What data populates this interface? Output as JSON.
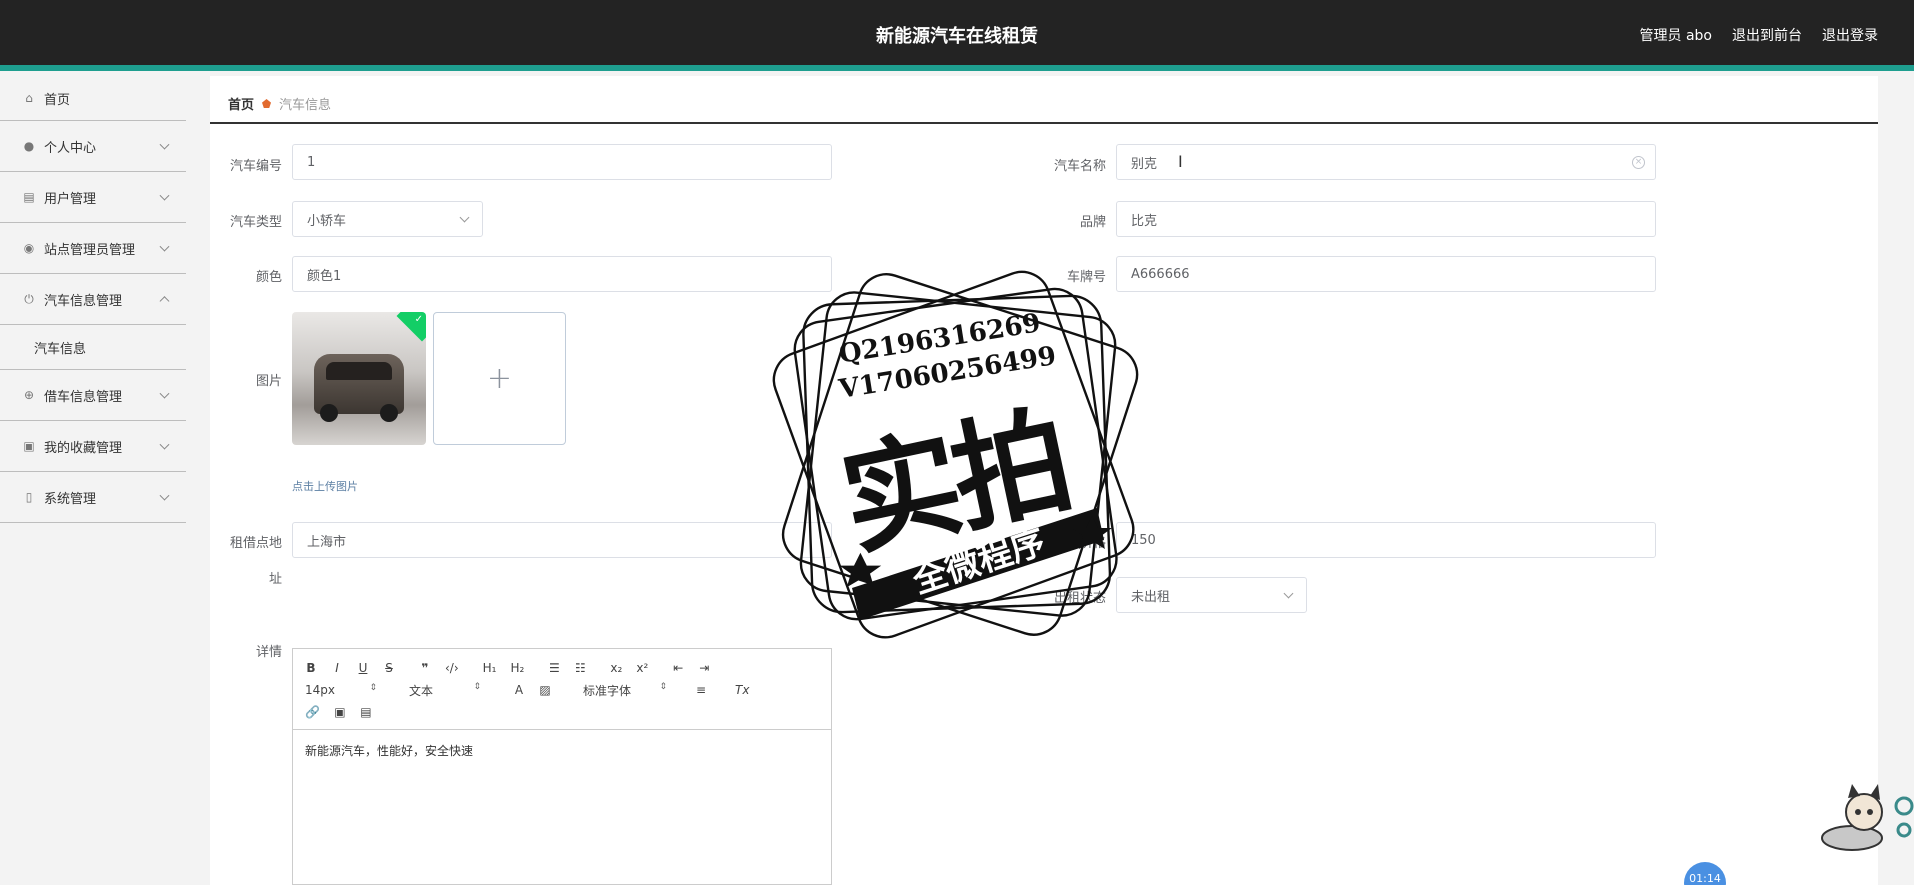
{
  "header": {
    "title": "新能源汽车在线租赁",
    "admin_label": "管理员 abo",
    "front_link": "退出到前台",
    "logout_link": "退出登录"
  },
  "sidebar": {
    "items": [
      {
        "label": "首页",
        "icon": "home-icon"
      },
      {
        "label": "个人中心",
        "icon": "user-icon"
      },
      {
        "label": "用户管理",
        "icon": "clipboard-icon"
      },
      {
        "label": "站点管理员管理",
        "icon": "location-icon"
      },
      {
        "label": "汽车信息管理",
        "icon": "power-icon"
      },
      {
        "label": "借车信息管理",
        "icon": "target-icon"
      },
      {
        "label": "我的收藏管理",
        "icon": "briefcase-icon"
      },
      {
        "label": "系统管理",
        "icon": "device-icon"
      }
    ],
    "sub_item": "汽车信息"
  },
  "breadcrumb": {
    "home": "首页",
    "current": "汽车信息"
  },
  "form": {
    "car_no_label": "汽车编号",
    "car_no_value": "1",
    "car_name_label": "汽车名称",
    "car_name_value": "别克",
    "car_type_label": "汽车类型",
    "car_type_value": "小轿车",
    "brand_label": "品牌",
    "brand_value": "比克",
    "color_label": "颜色",
    "color_value": "颜色1",
    "plate_label": "车牌号",
    "plate_value": "A666666",
    "image_label": "图片",
    "upload_hint": "点击上传图片",
    "location_label_1": "租借点地",
    "location_label_2": "址",
    "location_value": "上海市",
    "price_label": "价格",
    "price_value": "150",
    "status_label": "出租状态",
    "status_value": "未出租",
    "detail_label": "详情"
  },
  "editor": {
    "font_size": "14px",
    "text_style": "文本",
    "font_family": "标准字体",
    "content": "新能源汽车，性能好，安全快速"
  },
  "watermark": {
    "line1": "Q2196316269",
    "line2": "V17060256499",
    "big": "实拍",
    "ribbon": "全微程序"
  },
  "timer": "01:14"
}
